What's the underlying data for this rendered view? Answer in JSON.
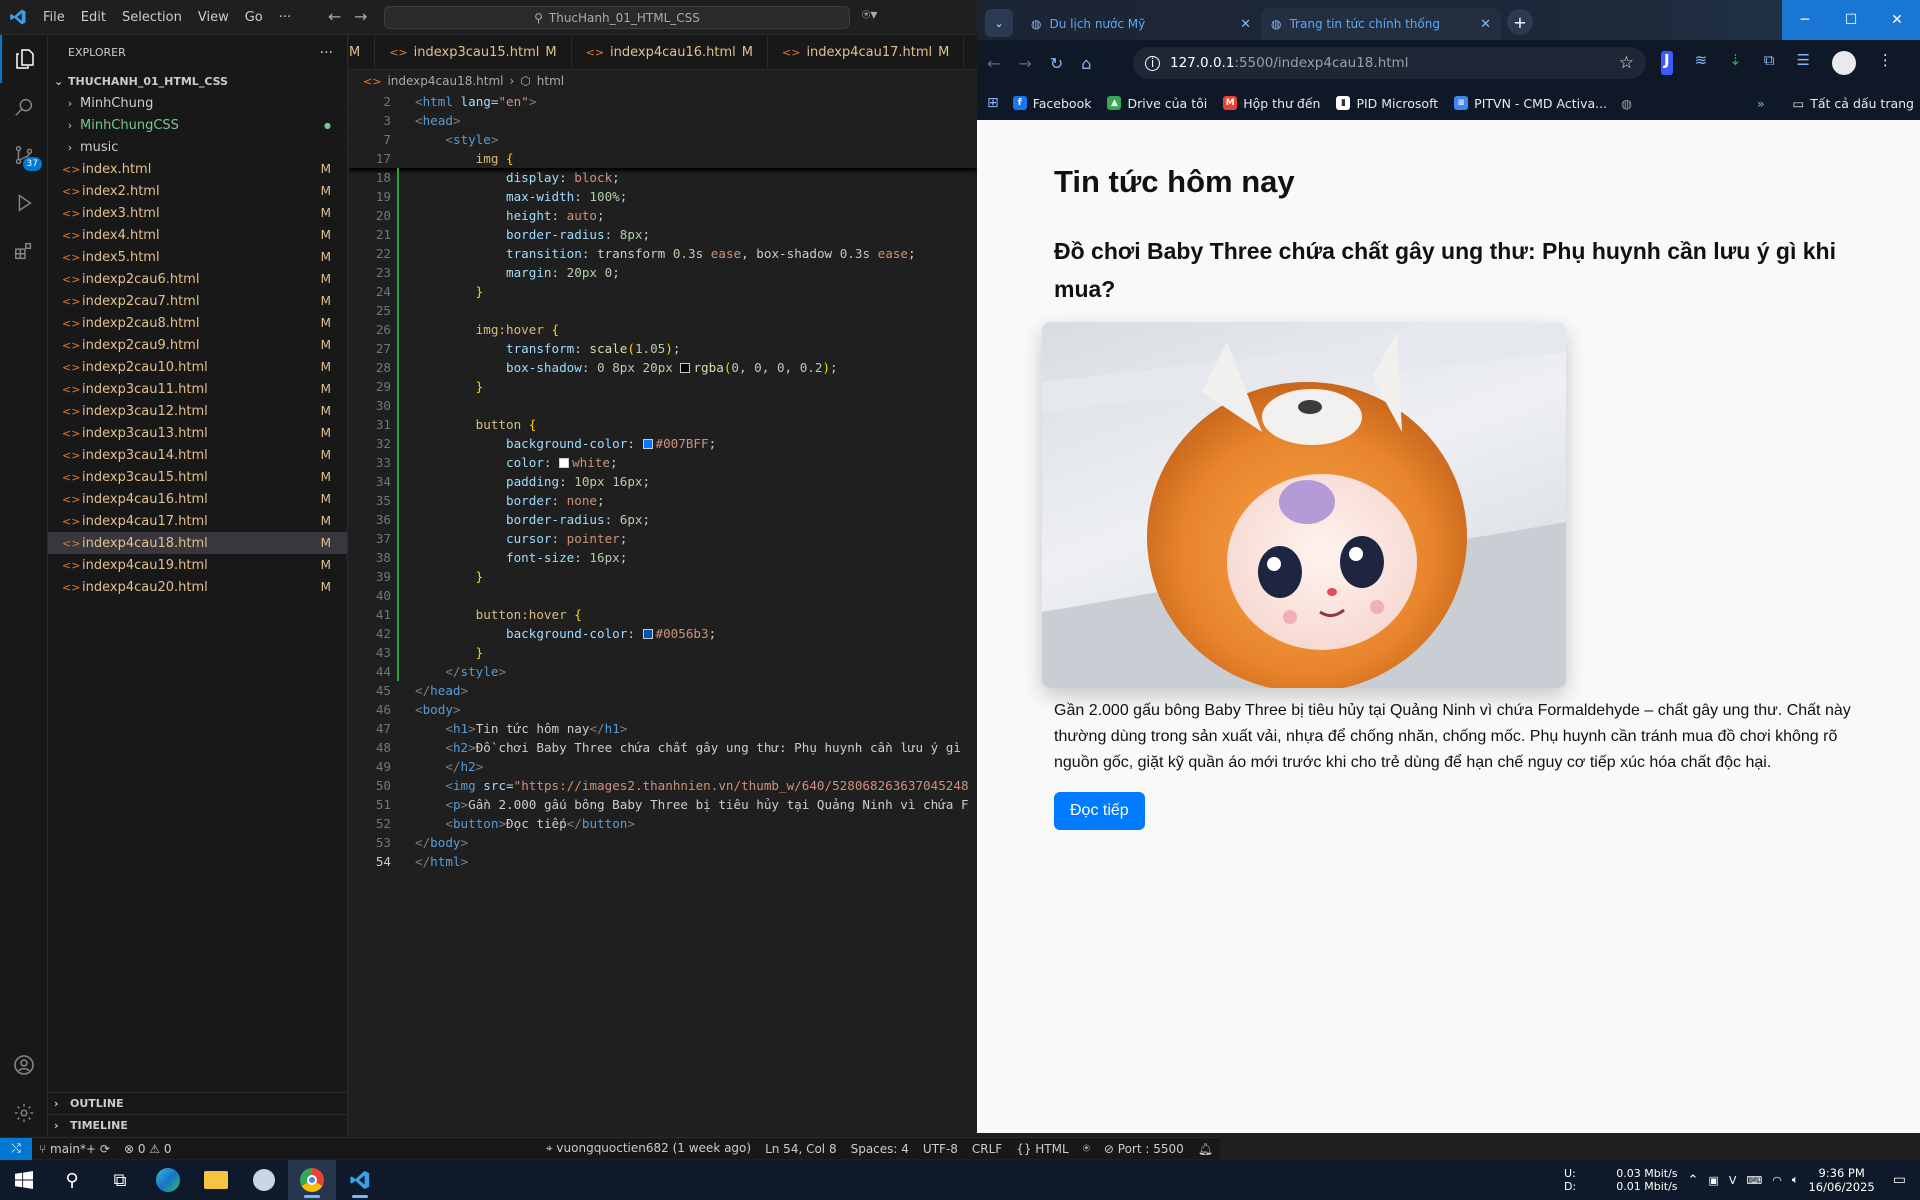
{
  "vscode": {
    "menu": [
      "File",
      "Edit",
      "Selection",
      "View",
      "Go",
      "···"
    ],
    "search_text": "ThucHanh_01_HTML_CSS",
    "explorer_title": "EXPLORER",
    "explorer_more": "···",
    "source_control_badge": "37",
    "folder_name": "THUCHANH_01_HTML_CSS",
    "tree": [
      {
        "name": "MinhChung",
        "type": "folder",
        "status": ""
      },
      {
        "name": "MinhChungCSS",
        "type": "folder",
        "status": "●"
      },
      {
        "name": "music",
        "type": "folder",
        "status": ""
      },
      {
        "name": "index.html",
        "type": "file",
        "status": "M"
      },
      {
        "name": "index2.html",
        "type": "file",
        "status": "M"
      },
      {
        "name": "index3.html",
        "type": "file",
        "status": "M"
      },
      {
        "name": "index4.html",
        "type": "file",
        "status": "M"
      },
      {
        "name": "index5.html",
        "type": "file",
        "status": "M"
      },
      {
        "name": "indexp2cau6.html",
        "type": "file",
        "status": "M"
      },
      {
        "name": "indexp2cau7.html",
        "type": "file",
        "status": "M"
      },
      {
        "name": "indexp2cau8.html",
        "type": "file",
        "status": "M"
      },
      {
        "name": "indexp2cau9.html",
        "type": "file",
        "status": "M"
      },
      {
        "name": "indexp2cau10.html",
        "type": "file",
        "status": "M"
      },
      {
        "name": "indexp3cau11.html",
        "type": "file",
        "status": "M"
      },
      {
        "name": "indexp3cau12.html",
        "type": "file",
        "status": "M"
      },
      {
        "name": "indexp3cau13.html",
        "type": "file",
        "status": "M"
      },
      {
        "name": "indexp3cau14.html",
        "type": "file",
        "status": "M"
      },
      {
        "name": "indexp3cau15.html",
        "type": "file",
        "status": "M"
      },
      {
        "name": "indexp4cau16.html",
        "type": "file",
        "status": "M"
      },
      {
        "name": "indexp4cau17.html",
        "type": "file",
        "status": "M"
      },
      {
        "name": "indexp4cau18.html",
        "type": "file",
        "status": "M",
        "selected": true
      },
      {
        "name": "indexp4cau19.html",
        "type": "file",
        "status": "M"
      },
      {
        "name": "indexp4cau20.html",
        "type": "file",
        "status": "M"
      }
    ],
    "outline_label": "OUTLINE",
    "timeline_label": "TIMELINE",
    "tabs": [
      {
        "label": "M",
        "mod": ""
      },
      {
        "label": "indexp3cau15.html",
        "mod": "M"
      },
      {
        "label": "indexp4cau16.html",
        "mod": "M"
      },
      {
        "label": "indexp4cau17.html",
        "mod": "M"
      }
    ],
    "breadcrumb": [
      "indexp4cau18.html",
      "html"
    ],
    "code_lines": [
      {
        "n": "2",
        "html": "<span class='pun'>&lt;</span><span class='tag'>html</span> <span class='attr'>lang</span><span class='txt'>=</span><span class='str'>\"en\"</span><span class='pun'>&gt;</span>",
        "sticky": true
      },
      {
        "n": "3",
        "html": "<span class='pun'>&lt;</span><span class='tag'>head</span><span class='pun'>&gt;</span>",
        "sticky": true
      },
      {
        "n": "7",
        "html": "    <span class='pun'>&lt;</span><span class='tag'>style</span><span class='pun'>&gt;</span>",
        "sticky": true
      },
      {
        "n": "17",
        "html": "        <span class='sel-c'>img</span> <span class='brk'>{</span>",
        "sticky": true
      },
      {
        "n": "18",
        "html": "            <span class='prop'>display</span>: <span class='val'>block</span>;",
        "mod": true
      },
      {
        "n": "19",
        "html": "            <span class='prop'>max-width</span>: <span class='num'>100%</span>;",
        "mod": true
      },
      {
        "n": "20",
        "html": "            <span class='prop'>height</span>: <span class='val'>auto</span>;",
        "mod": true
      },
      {
        "n": "21",
        "html": "            <span class='prop'>border-radius</span>: <span class='num'>8px</span>;",
        "mod": true
      },
      {
        "n": "22",
        "html": "            <span class='prop'>transition</span>: <span class='txt'>transform</span> <span class='num'>0.3s</span> <span class='val'>ease</span>, <span class='txt'>box-shadow</span> <span class='num'>0.3s</span> <span class='val'>ease</span>;",
        "mod": true
      },
      {
        "n": "23",
        "html": "            <span class='prop'>margin</span>: <span class='num'>20px</span> <span class='num'>0</span>;",
        "mod": true
      },
      {
        "n": "24",
        "html": "        <span class='brk'>}</span>",
        "mod": true
      },
      {
        "n": "25",
        "html": "",
        "mod": true
      },
      {
        "n": "26",
        "html": "        <span class='sel-c'>img:hover</span> <span class='brk'>{</span>",
        "mod": true
      },
      {
        "n": "27",
        "html": "            <span class='prop'>transform</span>: <span class='fn'>scale</span><span class='brk'>(</span><span class='num'>1.05</span><span class='brk'>)</span>;",
        "mod": true
      },
      {
        "n": "28",
        "html": "            <span class='prop'>box-shadow</span>: <span class='num'>0</span> <span class='num'>8px</span> <span class='num'>20px</span> <span class='sw' style='background:#000'></span><span class='fn'>rgba</span><span class='brk'>(</span><span class='num'>0</span>, <span class='num'>0</span>, <span class='num'>0</span>, <span class='num'>0.2</span><span class='brk'>)</span>;",
        "mod": true
      },
      {
        "n": "29",
        "html": "        <span class='brk'>}</span>",
        "mod": true
      },
      {
        "n": "30",
        "html": "",
        "mod": true
      },
      {
        "n": "31",
        "html": "        <span class='sel-c'>button</span> <span class='brk'>{</span>",
        "mod": true
      },
      {
        "n": "32",
        "html": "            <span class='prop'>background-color</span>: <span class='sw' style='background:#007BFF'></span><span class='val'>#007BFF</span>;",
        "mod": true
      },
      {
        "n": "33",
        "html": "            <span class='prop'>color</span>: <span class='sw' style='background:#fff'></span><span class='val'>white</span>;",
        "mod": true
      },
      {
        "n": "34",
        "html": "            <span class='prop'>padding</span>: <span class='num'>10px</span> <span class='num'>16px</span>;",
        "mod": true
      },
      {
        "n": "35",
        "html": "            <span class='prop'>border</span>: <span class='val'>none</span>;",
        "mod": true
      },
      {
        "n": "36",
        "html": "            <span class='prop'>border-radius</span>: <span class='num'>6px</span>;",
        "mod": true
      },
      {
        "n": "37",
        "html": "            <span class='prop'>cursor</span>: <span class='val'>pointer</span>;",
        "mod": true
      },
      {
        "n": "38",
        "html": "            <span class='prop'>font-size</span>: <span class='num'>16px</span>;",
        "mod": true
      },
      {
        "n": "39",
        "html": "        <span class='brk'>}</span>",
        "mod": true
      },
      {
        "n": "40",
        "html": "",
        "mod": true
      },
      {
        "n": "41",
        "html": "        <span class='sel-c'>button:hover</span> <span class='brk'>{</span>",
        "mod": true
      },
      {
        "n": "42",
        "html": "            <span class='prop'>background-color</span>: <span class='sw' style='background:#0056b3'></span><span class='val'>#0056b3</span>;",
        "mod": true
      },
      {
        "n": "43",
        "html": "        <span class='brk'>}</span>",
        "mod": true
      },
      {
        "n": "44",
        "html": "    <span class='pun'>&lt;/</span><span class='tag'>style</span><span class='pun'>&gt;</span>",
        "mod": true
      },
      {
        "n": "45",
        "html": "<span class='pun'>&lt;/</span><span class='tag'>head</span><span class='pun'>&gt;</span>"
      },
      {
        "n": "46",
        "html": "<span class='pun'>&lt;</span><span class='tag'>body</span><span class='pun'>&gt;</span>"
      },
      {
        "n": "47",
        "html": "    <span class='pun'>&lt;</span><span class='tag'>h1</span><span class='pun'>&gt;</span>Tin tức hôm nay<span class='pun'>&lt;/</span><span class='tag'>h1</span><span class='pun'>&gt;</span>"
      },
      {
        "n": "48",
        "html": "    <span class='pun'>&lt;</span><span class='tag'>h2</span><span class='pun'>&gt;</span>Đồ chơi Baby Three chứa chất gây ung thư: Phụ huynh cần lưu ý gì"
      },
      {
        "n": "49",
        "html": "    <span class='pun'>&lt;/</span><span class='tag'>h2</span><span class='pun'>&gt;</span>"
      },
      {
        "n": "50",
        "html": "    <span class='pun'>&lt;</span><span class='tag'>img</span> <span class='attr'>src</span>=<span class='str'>\"https://images2.thanhnien.vn/thumb_w/640/528068263637045248</span>"
      },
      {
        "n": "51",
        "html": "    <span class='pun'>&lt;</span><span class='tag'>p</span><span class='pun'>&gt;</span>Gần 2.000 gấu bông Baby Three bị tiêu hủy tại Quảng Ninh vì chứa F"
      },
      {
        "n": "52",
        "html": "    <span class='pun'>&lt;</span><span class='tag'>button</span><span class='pun'>&gt;</span>Đọc tiếp<span class='pun'>&lt;/</span><span class='tag'>button</span><span class='pun'>&gt;</span>"
      },
      {
        "n": "53",
        "html": "<span class='pun'>&lt;/</span><span class='tag'>body</span><span class='pun'>&gt;</span>"
      },
      {
        "n": "54",
        "html": "<span class='pun'>&lt;/</span><span class='tag'>html</span><span class='pun'>&gt;</span>",
        "current": true
      }
    ],
    "status": {
      "branch": "main*+",
      "sync": "⟳",
      "problems": "⊗ 0 ⚠ 0",
      "blame": "vuongquoctien682 (1 week ago)",
      "position": "Ln 54, Col 8",
      "spaces": "Spaces: 4",
      "encoding": "UTF-8",
      "eol": "CRLF",
      "language": "{} HTML",
      "port": "⊘ Port : 5500"
    }
  },
  "browser": {
    "tabs": [
      {
        "title": "Du lịch nước Mỹ",
        "active": false
      },
      {
        "title": "Trang tin tức chính thống",
        "active": true
      }
    ],
    "new_tab": "+",
    "url_host": "127.0.0.1",
    "url_path": ":5500/indexp4cau18.html",
    "bookmarks": [
      {
        "label": "Facebook",
        "color": "#1877f2",
        "glyph": "f"
      },
      {
        "label": "Drive của tôi",
        "color": "#34a853",
        "glyph": "▲"
      },
      {
        "label": "Hộp thư đến",
        "color": "#ea4335",
        "glyph": "M"
      },
      {
        "label": "PID Microsoft",
        "color": "#ffffff",
        "glyph": "▮"
      },
      {
        "label": "PITVN - CMD Activa...",
        "color": "#4285f4",
        "glyph": "≡"
      }
    ],
    "bookmarks_more": "»",
    "all_bookmarks": "Tất cả dấu trang",
    "page": {
      "h1": "Tin tức hôm nay",
      "h2": "Đồ chơi Baby Three chứa chất gây ung thư: Phụ huynh cần lưu ý gì khi mua?",
      "paragraph": "Gần 2.000 gấu bông Baby Three bị tiêu hủy tại Quảng Ninh vì chứa Formaldehyde – chất gây ung thư. Chất này thường dùng trong sản xuất vải, nhựa để chống nhăn, chống mốc. Phụ huynh cần tránh mua đồ chơi không rõ nguồn gốc, giặt kỹ quần áo mới trước khi cho trẻ dùng để hạn chế nguy cơ tiếp xúc hóa chất độc hại.",
      "button": "Đọc tiếp"
    }
  },
  "taskbar": {
    "net_up_label": "U:",
    "net_down_label": "D:",
    "net_up": "0.03 Mbit/s",
    "net_down": "0.01 Mbit/s",
    "time": "9:36 PM",
    "date": "16/06/2025"
  }
}
